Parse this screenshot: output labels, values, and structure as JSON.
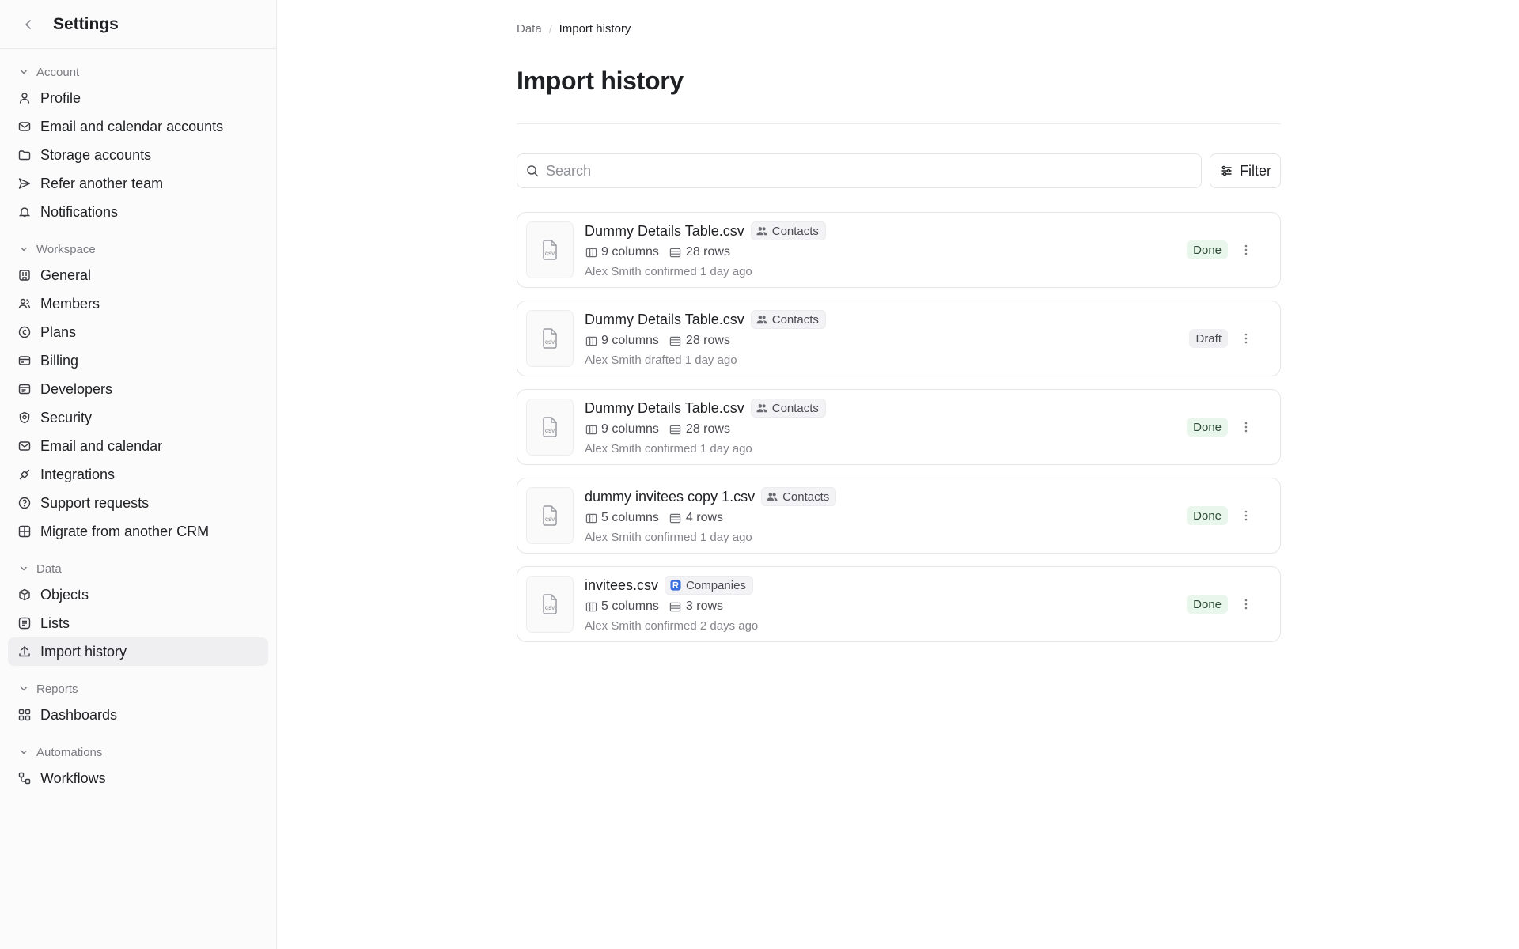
{
  "sidebar": {
    "title": "Settings",
    "sections": [
      {
        "label": "Account",
        "items": [
          {
            "label": "Profile",
            "icon": "user-icon"
          },
          {
            "label": "Email and calendar accounts",
            "icon": "mail-icon"
          },
          {
            "label": "Storage accounts",
            "icon": "folder-icon"
          },
          {
            "label": "Refer another team",
            "icon": "send-icon"
          },
          {
            "label": "Notifications",
            "icon": "bell-icon"
          }
        ]
      },
      {
        "label": "Workspace",
        "items": [
          {
            "label": "General",
            "icon": "building-icon"
          },
          {
            "label": "Members",
            "icon": "users-icon"
          },
          {
            "label": "Plans",
            "icon": "coin-icon"
          },
          {
            "label": "Billing",
            "icon": "card-icon"
          },
          {
            "label": "Developers",
            "icon": "code-window-icon"
          },
          {
            "label": "Security",
            "icon": "shield-icon"
          },
          {
            "label": "Email and calendar",
            "icon": "mail-icon"
          },
          {
            "label": "Integrations",
            "icon": "plug-icon"
          },
          {
            "label": "Support requests",
            "icon": "help-circle-icon"
          },
          {
            "label": "Migrate from another CRM",
            "icon": "migrate-icon"
          }
        ]
      },
      {
        "label": "Data",
        "items": [
          {
            "label": "Objects",
            "icon": "cube-icon"
          },
          {
            "label": "Lists",
            "icon": "lists-icon"
          },
          {
            "label": "Import history",
            "icon": "upload-icon",
            "active": true
          }
        ]
      },
      {
        "label": "Reports",
        "items": [
          {
            "label": "Dashboards",
            "icon": "dashboard-icon"
          }
        ]
      },
      {
        "label": "Automations",
        "items": [
          {
            "label": "Workflows",
            "icon": "workflow-icon"
          }
        ]
      }
    ]
  },
  "main": {
    "breadcrumb": {
      "parent": "Data",
      "current": "Import history"
    },
    "title": "Import history",
    "search": {
      "placeholder": "Search",
      "value": ""
    },
    "filter_label": "Filter",
    "imports": [
      {
        "file": "Dummy Details Table.csv",
        "object": "Contacts",
        "object_icon": "contacts-icon",
        "columns": "9 columns",
        "rows": "28 rows",
        "by": "Alex Smith confirmed 1 day ago",
        "status": "Done"
      },
      {
        "file": "Dummy Details Table.csv",
        "object": "Contacts",
        "object_icon": "contacts-icon",
        "columns": "9 columns",
        "rows": "28 rows",
        "by": "Alex Smith drafted 1 day ago",
        "status": "Draft"
      },
      {
        "file": "Dummy Details Table.csv",
        "object": "Contacts",
        "object_icon": "contacts-icon",
        "columns": "9 columns",
        "rows": "28 rows",
        "by": "Alex Smith confirmed 1 day ago",
        "status": "Done"
      },
      {
        "file": "dummy invitees copy 1.csv",
        "object": "Contacts",
        "object_icon": "contacts-icon",
        "columns": "5 columns",
        "rows": "4 rows",
        "by": "Alex Smith confirmed 1 day ago",
        "status": "Done"
      },
      {
        "file": "invitees.csv",
        "object": "Companies",
        "object_icon": "companies-icon",
        "columns": "5 columns",
        "rows": "3 rows",
        "by": "Alex Smith confirmed 2 days ago",
        "status": "Done"
      }
    ]
  },
  "colors": {
    "active_bg": "#efeff1",
    "done_bg": "#e9f6ec",
    "draft_bg": "#f0f0f2",
    "companies_badge": "#3b6fe0"
  }
}
